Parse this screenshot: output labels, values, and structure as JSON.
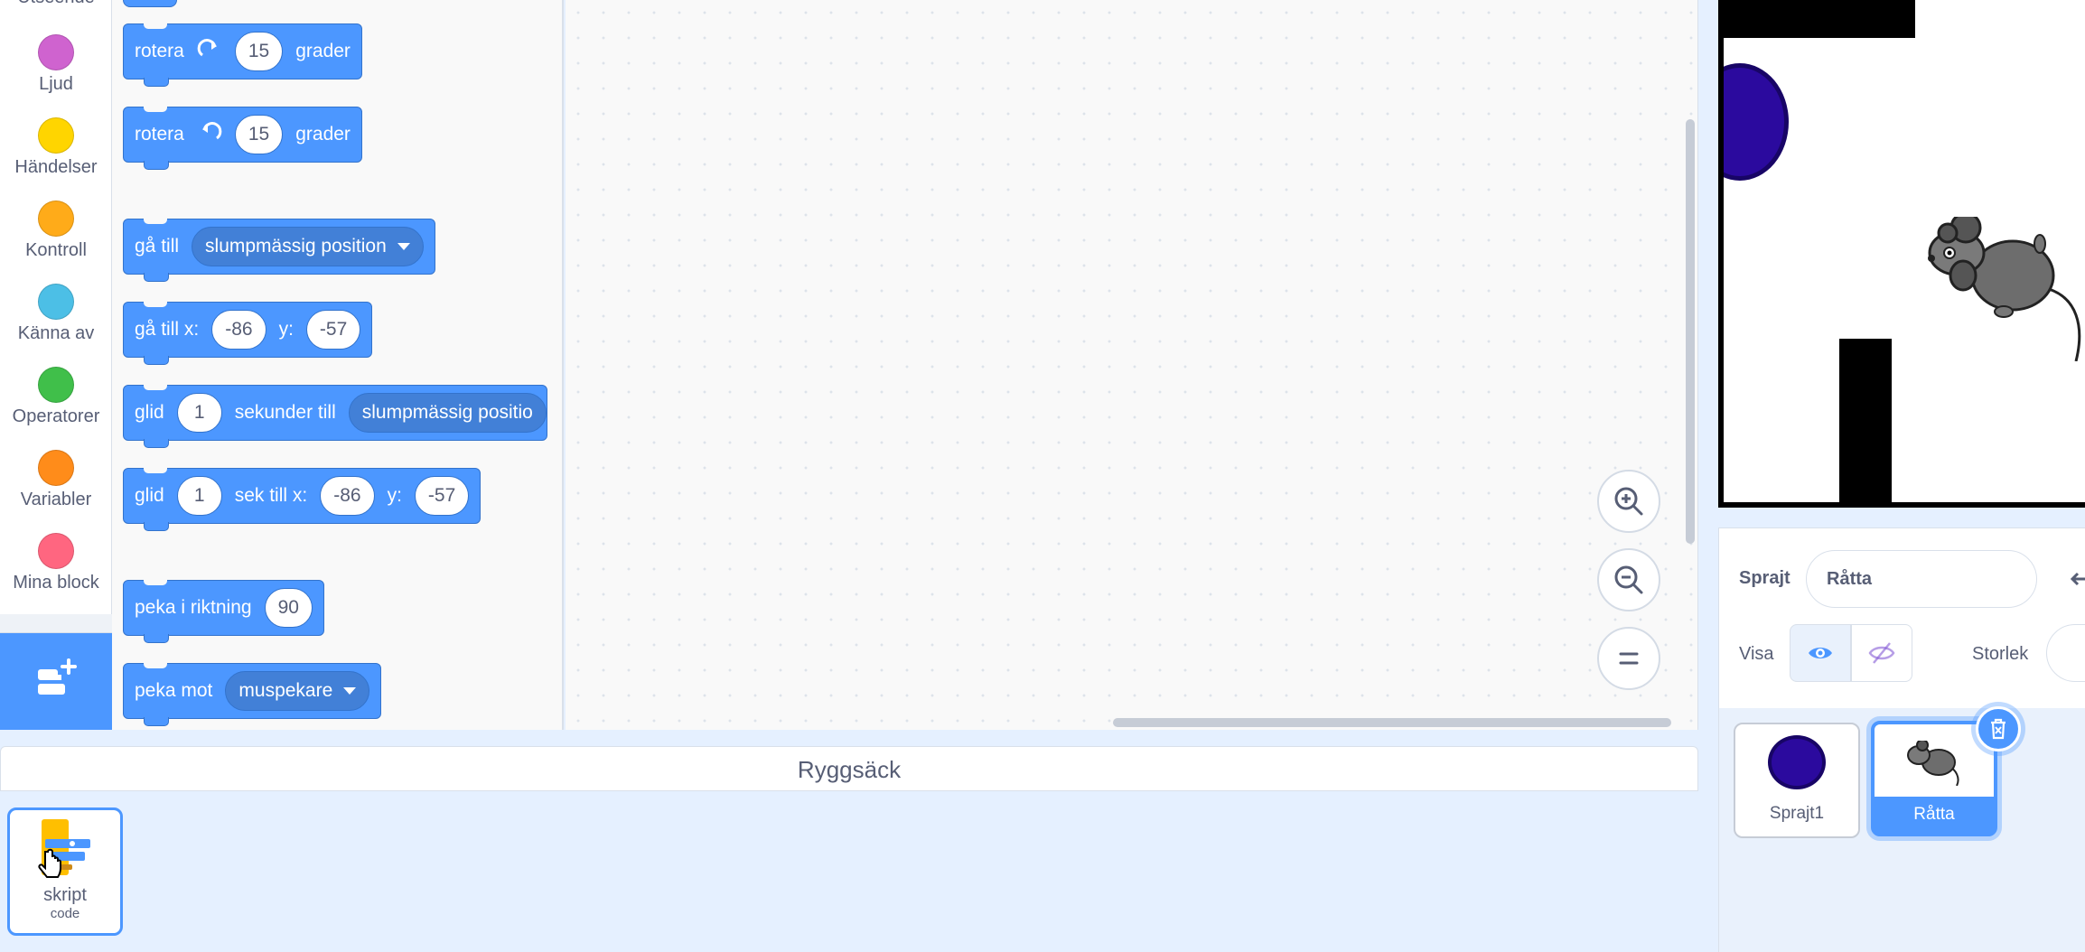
{
  "categories": [
    {
      "label": "Utseende",
      "color": "#9966ff"
    },
    {
      "label": "Ljud",
      "color": "#cf63cf"
    },
    {
      "label": "Händelser",
      "color": "#ffd500"
    },
    {
      "label": "Kontroll",
      "color": "#ffab19"
    },
    {
      "label": "Känna av",
      "color": "#4cbfe6"
    },
    {
      "label": "Operatorer",
      "color": "#40bf4a"
    },
    {
      "label": "Variabler",
      "color": "#ff8c1a"
    },
    {
      "label": "Mina block",
      "color": "#ff6680"
    }
  ],
  "blocks": {
    "turn_right": {
      "label": "rotera",
      "value": "15",
      "suffix": "grader"
    },
    "turn_left": {
      "label": "rotera",
      "value": "15",
      "suffix": "grader"
    },
    "goto": {
      "label": "gå till",
      "menu": "slumpmässig position"
    },
    "goto_xy": {
      "label": "gå till x:",
      "x": "-86",
      "y_label": "y:",
      "y": "-57"
    },
    "glide": {
      "label": "glid",
      "secs": "1",
      "mid": "sekunder till",
      "menu": "slumpmässig positio"
    },
    "glide_xy": {
      "label": "glid",
      "secs": "1",
      "mid": "sek till x:",
      "x": "-86",
      "y_label": "y:",
      "y": "-57"
    },
    "point_dir": {
      "label": "peka i riktning",
      "value": "90"
    },
    "point_towards": {
      "label": "peka mot",
      "menu": "muspekare"
    }
  },
  "backpack": {
    "title": "Ryggsäck",
    "item": {
      "name": "skript",
      "type": "code"
    }
  },
  "sprite_info": {
    "sprite_label": "Sprajt",
    "sprite_name": "Råtta",
    "show_label": "Visa",
    "size_label": "Storlek"
  },
  "sprites": [
    {
      "name": "Sprajt1",
      "selected": false
    },
    {
      "name": "Råtta",
      "selected": true
    }
  ],
  "colors": {
    "motion": "#4c97ff",
    "accent": "#4c97ff"
  }
}
